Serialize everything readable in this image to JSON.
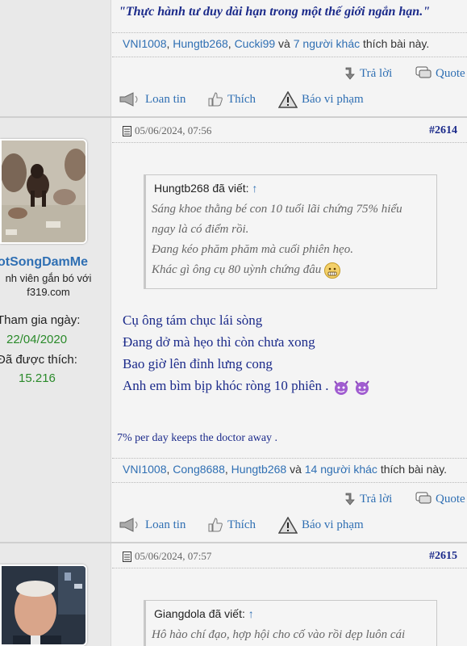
{
  "post1": {
    "quote_line": "\"Thực hành tư duy dài hạn trong một thế giới ngắn hạn.\"",
    "likers": [
      "VNI1008",
      "Hungtb268",
      "Cucki99"
    ],
    "likes_and": "và",
    "likes_others": "7 người khác",
    "likes_suffix": "thích bài này.",
    "reply_label": "Trả lời",
    "quote_label": "Quote",
    "spam_label": "Loan tin",
    "like_label": "Thích",
    "report_label": "Báo vi phạm"
  },
  "post2": {
    "timestamp": "05/06/2024, 07:56",
    "number": "#2614",
    "user": {
      "name": "otSongDamMe",
      "title_line1": "nh viên gắn bó với",
      "title_line2": "f319.com",
      "joined_label": "Tham gia ngày:",
      "joined_value": "22/04/2020",
      "likes_label": "Đã được thích:",
      "likes_value": "15.216"
    },
    "quote": {
      "author": "Hungtb268 đã viết:",
      "arrow": "↑",
      "lines": [
        "Sáng khoe thằng bé con 10 tuổi lãi chứng 75% hiểu",
        "ngay là có điểm rồi.",
        "Đang kéo phăm phăm mà cuối phiên hẹo.",
        "Khác gì ông cụ 80 uỳnh chứng đâu"
      ]
    },
    "lines": [
      "Cụ ông tám chục lái sòng",
      "Đang dở mà hẹo thì còn chưa xong",
      "Bao giờ lên đỉnh lưng cong",
      "Anh em bìm bịp khóc ròng 10 phiên ."
    ],
    "signature": "7% per day keeps the doctor away .",
    "likers": [
      "VNI1008",
      "Cong8688",
      "Hungtb268"
    ],
    "likes_and": "và",
    "likes_others": "14 người khác",
    "likes_suffix": "thích bài này.",
    "reply_label": "Trả lời",
    "quote_label": "Quote",
    "spam_label": "Loan tin",
    "like_label": "Thích",
    "report_label": "Báo vi phạm"
  },
  "post3": {
    "timestamp": "05/06/2024, 07:57",
    "number": "#2615",
    "quote": {
      "author": "Giangdola đã viết:",
      "arrow": "↑",
      "first_line": "Hô hào chí đạo, hợp hội cho cố vào rồi dẹp luôn cái"
    }
  },
  "colors": {
    "link": "#2f6fb3",
    "post_text": "#1b2a8a",
    "stat_value": "#2a8a2a"
  }
}
